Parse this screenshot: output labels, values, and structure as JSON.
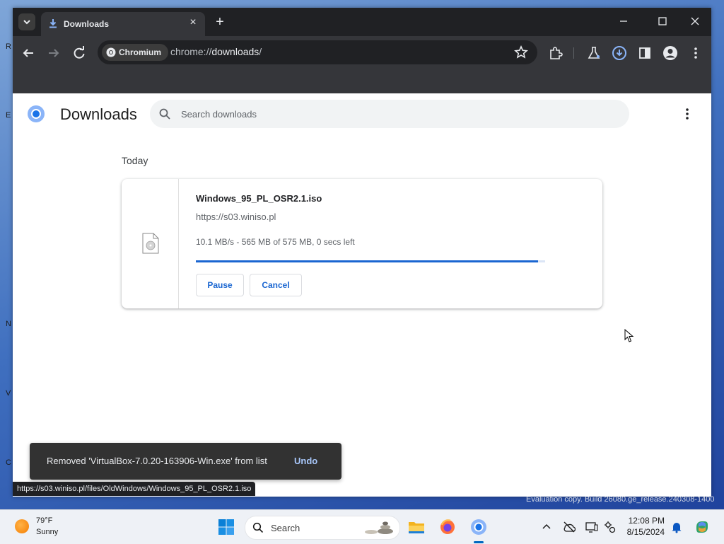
{
  "desktop": {
    "edge_letters": [
      "R",
      "E",
      "N",
      "V",
      "C"
    ],
    "watermark": "Evaluation copy. Build 26080.ge_release.240308-1400"
  },
  "browser": {
    "tab": {
      "title": "Downloads",
      "icon": "download-icon"
    },
    "omnibox": {
      "chip_label": "Chromium",
      "url_prefix": "chrome://",
      "url_host": "downloads",
      "url_suffix": "/"
    },
    "colors": {
      "frame": "#202124",
      "toolbar": "#35363a",
      "accent": "#1a66d1"
    }
  },
  "page": {
    "title": "Downloads",
    "search_placeholder": "Search downloads",
    "section_label": "Today",
    "download": {
      "filename": "Windows_95_PL_OSR2.1.iso",
      "source_url": "https://s03.winiso.pl",
      "status": "10.1 MB/s - 565 MB of 575 MB, 0 secs left",
      "progress_percent": 98,
      "pause_label": "Pause",
      "cancel_label": "Cancel"
    },
    "toast": {
      "message": "Removed 'VirtualBox-7.0.20-163906-Win.exe' from list",
      "action": "Undo"
    },
    "status_url": "https://s03.winiso.pl/files/OldWindows/Windows_95_PL_OSR2.1.iso"
  },
  "taskbar": {
    "weather": {
      "temp": "79°F",
      "condition": "Sunny"
    },
    "search_label": "Search",
    "apps": [
      "start-icon",
      "file-explorer-icon",
      "firefox-icon",
      "chromium-icon"
    ],
    "tray": [
      "chevron-up-icon",
      "network-off-icon",
      "display-icon",
      "accessibility-icon",
      "notification-bell-icon",
      "copilot-icon"
    ],
    "clock": {
      "time": "12:08 PM",
      "date": "8/15/2024"
    }
  }
}
